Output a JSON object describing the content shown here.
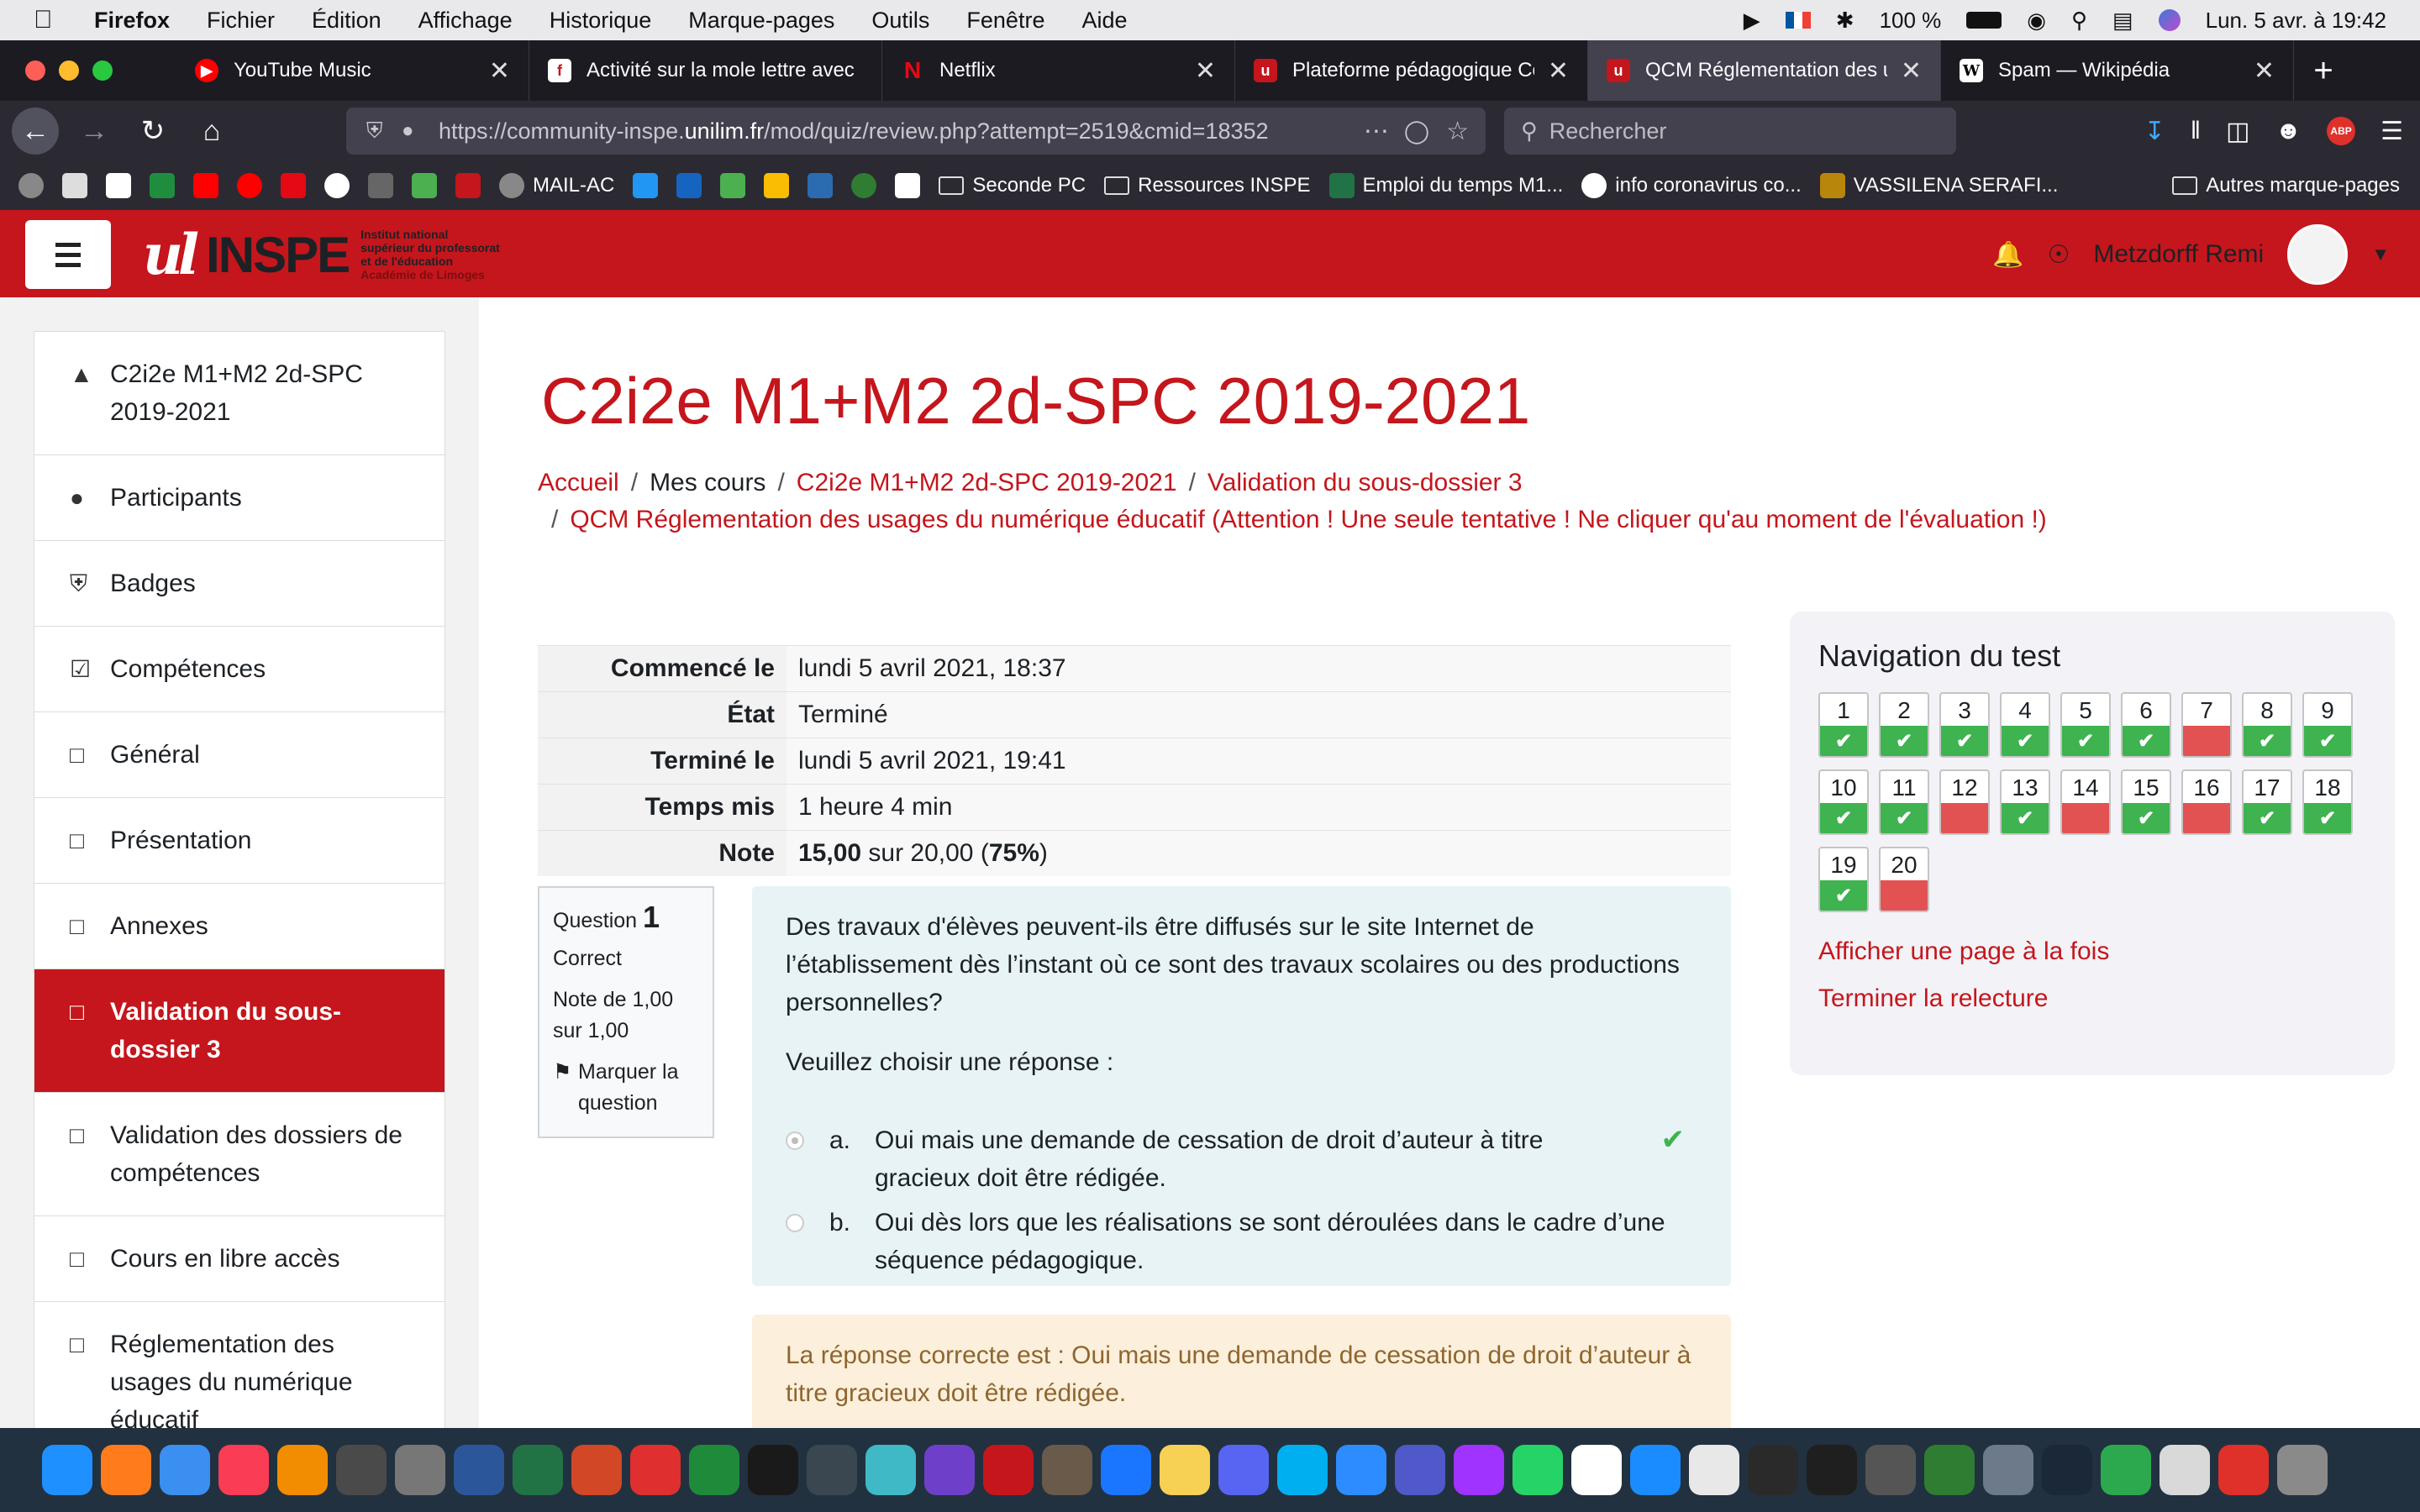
{
  "menubar": {
    "app": "Firefox",
    "items": [
      "Fichier",
      "Édition",
      "Affichage",
      "Historique",
      "Marque-pages",
      "Outils",
      "Fenêtre",
      "Aide"
    ],
    "battery": "100 %",
    "clock": "Lun. 5 avr. à  19:42"
  },
  "tabs": [
    {
      "title": "YouTube Music",
      "icon": "youtube-music-icon",
      "color": "#ff0000"
    },
    {
      "title": "Activité sur la mole lettre avec",
      "icon": "activity-icon",
      "color": "#c4161c"
    },
    {
      "title": "Netflix",
      "icon": "netflix-icon",
      "color": "#e50914"
    },
    {
      "title": "Plateforme pédagogique Cours",
      "icon": "inspe-icon",
      "color": "#c4161c"
    },
    {
      "title": "QCM Réglementation des usages",
      "icon": "inspe-icon",
      "color": "#c4161c"
    },
    {
      "title": "Spam — Wikipédia",
      "icon": "wikipedia-icon",
      "color": "#ffffff"
    }
  ],
  "url": {
    "prefix": "https://community-inspe.",
    "domain": "unilim.fr",
    "path": "/mod/quiz/review.php?attempt=2519&cmid=18352"
  },
  "search": {
    "placeholder": "Rechercher"
  },
  "bookmarks": [
    {
      "label": "MAIL-AC",
      "type": "site"
    },
    {
      "label": "Seconde PC",
      "type": "folder"
    },
    {
      "label": "Ressources INSPE",
      "type": "folder"
    },
    {
      "label": "Emploi du temps M1...",
      "type": "site"
    },
    {
      "label": "info coronavirus co...",
      "type": "site"
    },
    {
      "label": "VASSILENA SERAFI...",
      "type": "site"
    },
    {
      "label": "Autres marque-pages",
      "type": "folder"
    }
  ],
  "site": {
    "logo_main": "INSPE",
    "logo_sub": [
      "Institut national",
      "supérieur du professorat",
      "et de l'éducation",
      "Académie de Limoges"
    ],
    "user": "Metzdorff Remi"
  },
  "sidebar": [
    {
      "label": "C2i2e M1+M2 2d-SPC 2019-2021",
      "icon": "graduation-cap-icon",
      "active": false
    },
    {
      "label": "Participants",
      "icon": "users-icon",
      "active": false
    },
    {
      "label": "Badges",
      "icon": "shield-icon",
      "active": false
    },
    {
      "label": "Compétences",
      "icon": "checkbox-icon",
      "active": false
    },
    {
      "label": "Général",
      "icon": "folder-icon",
      "active": false
    },
    {
      "label": "Présentation",
      "icon": "folder-icon",
      "active": false
    },
    {
      "label": "Annexes",
      "icon": "folder-icon",
      "active": false
    },
    {
      "label": "Validation du sous-dossier 3",
      "icon": "folder-icon",
      "active": true
    },
    {
      "label": "Validation des dossiers de compétences",
      "icon": "folder-icon",
      "active": false
    },
    {
      "label": "Cours en libre accès",
      "icon": "folder-icon",
      "active": false
    },
    {
      "label": "Réglementation des usages du numérique éducatif",
      "icon": "folder-icon",
      "active": false
    }
  ],
  "page": {
    "title": "C2i2e M1+M2 2d-SPC 2019-2021",
    "breadcrumb": [
      "Accueil",
      "Mes cours",
      "C2i2e M1+M2 2d-SPC 2019-2021",
      "Validation du sous-dossier 3"
    ],
    "breadcrumb_last": "QCM Réglementation des usages du numérique éducatif (Attention ! Une seule tentative ! Ne cliquer qu'au moment de l'évaluation !)"
  },
  "summary": [
    {
      "label": "Commencé le",
      "value": "lundi 5 avril 2021, 18:37"
    },
    {
      "label": "État",
      "value": "Terminé"
    },
    {
      "label": "Terminé le",
      "value": "lundi 5 avril 2021, 19:41"
    },
    {
      "label": "Temps mis",
      "value": "1 heure 4 min"
    }
  ],
  "grade": {
    "label": "Note",
    "score": "15,00",
    "mid": " sur 20,00 (",
    "pct": "75%",
    "end": ")"
  },
  "question": {
    "prefix": "Question",
    "number": "1",
    "state": "Correct",
    "mark": "Note de 1,00 sur 1,00",
    "flag": "Marquer la question",
    "text": "Des travaux d'élèves peuvent-ils être diffusés sur le site Internet de l’établissement dès l’instant où ce sont des travaux scolaires ou des productions personnelles?",
    "prompt": "Veuillez choisir une réponse :",
    "options": [
      {
        "letter": "a.",
        "text": "Oui mais une demande de cessation de droit d’auteur à titre gracieux doit être rédigée.",
        "selected": true,
        "correct": true
      },
      {
        "letter": "b.",
        "text": "Oui dès lors que les réalisations se sont déroulées dans le cadre d’une séquence pédagogique.",
        "selected": false,
        "correct": false
      }
    ],
    "right_answer": "La réponse correcte est : Oui mais une demande de cessation de droit d’auteur à titre gracieux doit être rédigée."
  },
  "quiz_nav": {
    "title": "Navigation du test",
    "questions": [
      {
        "n": "1",
        "state": "correct"
      },
      {
        "n": "2",
        "state": "correct"
      },
      {
        "n": "3",
        "state": "correct"
      },
      {
        "n": "4",
        "state": "correct"
      },
      {
        "n": "5",
        "state": "correct"
      },
      {
        "n": "6",
        "state": "correct"
      },
      {
        "n": "7",
        "state": "incorrect"
      },
      {
        "n": "8",
        "state": "correct"
      },
      {
        "n": "9",
        "state": "correct"
      },
      {
        "n": "10",
        "state": "correct"
      },
      {
        "n": "11",
        "state": "correct"
      },
      {
        "n": "12",
        "state": "incorrect"
      },
      {
        "n": "13",
        "state": "correct"
      },
      {
        "n": "14",
        "state": "incorrect"
      },
      {
        "n": "15",
        "state": "correct"
      },
      {
        "n": "16",
        "state": "incorrect"
      },
      {
        "n": "17",
        "state": "correct"
      },
      {
        "n": "18",
        "state": "correct"
      },
      {
        "n": "19",
        "state": "correct"
      },
      {
        "n": "20",
        "state": "incorrect"
      }
    ],
    "link_page": "Afficher une page à la fois",
    "link_finish": "Terminer la relecture"
  },
  "dock": [
    {
      "name": "finder",
      "color": "#1e90ff"
    },
    {
      "name": "firefox",
      "color": "#ff7b1c"
    },
    {
      "name": "mail",
      "color": "#3b8ff0"
    },
    {
      "name": "music",
      "color": "#fa3d55"
    },
    {
      "name": "vlc",
      "color": "#f28c00"
    },
    {
      "name": "quicktime",
      "color": "#4a4a4a"
    },
    {
      "name": "texmaker",
      "color": "#777777"
    },
    {
      "name": "word",
      "color": "#2b579a"
    },
    {
      "name": "excel",
      "color": "#217346"
    },
    {
      "name": "powerpoint",
      "color": "#d24726"
    },
    {
      "name": "acrobat",
      "color": "#e02f2f"
    },
    {
      "name": "app-circle",
      "color": "#1f8a3a"
    },
    {
      "name": "pycharm",
      "color": "#1a1a1a"
    },
    {
      "name": "davinci",
      "color": "#3a4750"
    },
    {
      "name": "atom",
      "color": "#3fb9c6"
    },
    {
      "name": "github",
      "color": "#6e40c9"
    },
    {
      "name": "mindmap",
      "color": "#c4161c"
    },
    {
      "name": "gimp",
      "color": "#6a5a4a"
    },
    {
      "name": "safari",
      "color": "#1a75ff"
    },
    {
      "name": "notes",
      "color": "#f7d154"
    },
    {
      "name": "discord",
      "color": "#5865f2"
    },
    {
      "name": "skype",
      "color": "#00aff0"
    },
    {
      "name": "zoom",
      "color": "#2d8cff"
    },
    {
      "name": "teams",
      "color": "#5059c9"
    },
    {
      "name": "messenger",
      "color": "#a033ff"
    },
    {
      "name": "whatsapp",
      "color": "#25d366"
    },
    {
      "name": "calendar",
      "color": "#ffffff"
    },
    {
      "name": "appstore",
      "color": "#1a8cff"
    },
    {
      "name": "textedit",
      "color": "#e8e8e8"
    },
    {
      "name": "terminal",
      "color": "#2a2a2a"
    },
    {
      "name": "activity-monitor",
      "color": "#1f1f1f"
    },
    {
      "name": "time-machine",
      "color": "#555555"
    },
    {
      "name": "not",
      "color": "#2e7d32"
    },
    {
      "name": "preview",
      "color": "#6c7a89"
    },
    {
      "name": "steam",
      "color": "#1b2838"
    },
    {
      "name": "numbers",
      "color": "#2ca94f"
    },
    {
      "name": "documents",
      "color": "#d9d9d9"
    },
    {
      "name": "adblock",
      "color": "#e0302a"
    },
    {
      "name": "trash",
      "color": "#8a8a8a"
    }
  ]
}
